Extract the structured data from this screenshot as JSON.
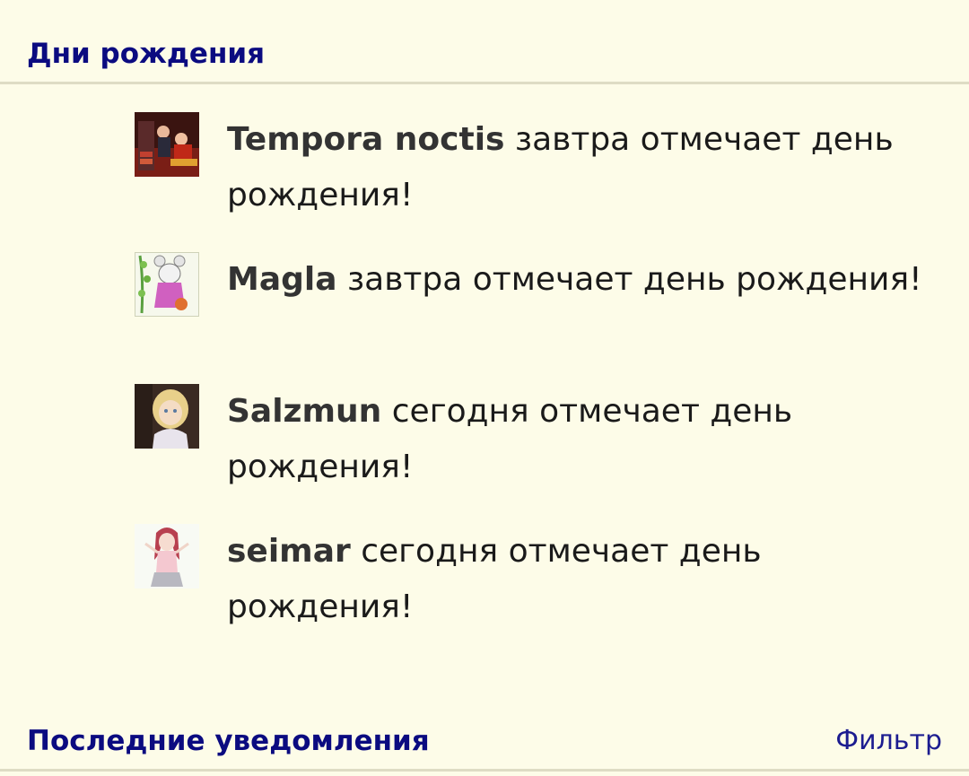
{
  "birthdays_section": {
    "title": "Дни рождения",
    "items": [
      {
        "name": "Tempora noctis",
        "text": "завтра отмечает день рождения!",
        "avatar": "avatar-tempora-noctis"
      },
      {
        "name": "Magla",
        "text": "завтра отмечает день рождения!",
        "avatar": "avatar-magla"
      },
      {
        "name": "Salzmun",
        "text": "сегодня отмечает день рождения!",
        "avatar": "avatar-salzmun"
      },
      {
        "name": "seimar",
        "text": "сегодня отмечает день рождения!",
        "avatar": "avatar-seimar"
      }
    ]
  },
  "notifications_section": {
    "title": "Последние уведомления",
    "filter_label": "Фильтр"
  },
  "colors": {
    "background": "#fdfce8",
    "heading": "#0b0b80",
    "divider": "#dedcc4",
    "username": "#333333"
  }
}
